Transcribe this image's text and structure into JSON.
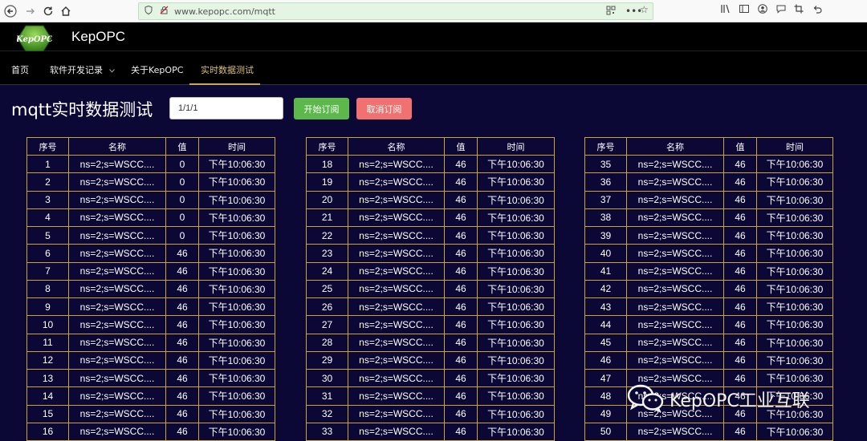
{
  "browser": {
    "url": "www.kepopc.com/mqtt"
  },
  "site": {
    "logo_text": "KepOPC",
    "title": "KepOPC"
  },
  "nav": {
    "items": [
      {
        "label": "首页"
      },
      {
        "label": "软件开发记录"
      },
      {
        "label": "关于KepOPC"
      },
      {
        "label": "实时数据测试"
      }
    ]
  },
  "page": {
    "title": "mqtt实时数据测试",
    "topic_value": "1/1/1",
    "subscribe_label": "开始订阅",
    "unsubscribe_label": "取消订阅"
  },
  "table": {
    "headers": [
      "序号",
      "名称",
      "值",
      "时间"
    ],
    "groups": [
      {
        "rows": [
          [
            "1",
            "ns=2;s=WSCC....",
            "0",
            "下午10:06:30"
          ],
          [
            "2",
            "ns=2;s=WSCC....",
            "0",
            "下午10:06:30"
          ],
          [
            "3",
            "ns=2;s=WSCC....",
            "0",
            "下午10:06:30"
          ],
          [
            "4",
            "ns=2;s=WSCC....",
            "0",
            "下午10:06:30"
          ],
          [
            "5",
            "ns=2;s=WSCC....",
            "0",
            "下午10:06:30"
          ],
          [
            "6",
            "ns=2;s=WSCC....",
            "46",
            "下午10:06:30"
          ],
          [
            "7",
            "ns=2;s=WSCC....",
            "46",
            "下午10:06:30"
          ],
          [
            "8",
            "ns=2;s=WSCC....",
            "46",
            "下午10:06:30"
          ],
          [
            "9",
            "ns=2;s=WSCC....",
            "46",
            "下午10:06:30"
          ],
          [
            "10",
            "ns=2;s=WSCC....",
            "46",
            "下午10:06:30"
          ],
          [
            "11",
            "ns=2;s=WSCC....",
            "46",
            "下午10:06:30"
          ],
          [
            "12",
            "ns=2;s=WSCC....",
            "46",
            "下午10:06:30"
          ],
          [
            "13",
            "ns=2;s=WSCC....",
            "46",
            "下午10:06:30"
          ],
          [
            "14",
            "ns=2;s=WSCC....",
            "46",
            "下午10:06:30"
          ],
          [
            "15",
            "ns=2;s=WSCC....",
            "46",
            "下午10:06:30"
          ],
          [
            "16",
            "ns=2;s=WSCC....",
            "46",
            "下午10:06:30"
          ]
        ]
      },
      {
        "rows": [
          [
            "18",
            "ns=2;s=WSCC....",
            "46",
            "下午10:06:30"
          ],
          [
            "19",
            "ns=2;s=WSCC....",
            "46",
            "下午10:06:30"
          ],
          [
            "20",
            "ns=2;s=WSCC....",
            "46",
            "下午10:06:30"
          ],
          [
            "21",
            "ns=2;s=WSCC....",
            "46",
            "下午10:06:30"
          ],
          [
            "22",
            "ns=2;s=WSCC....",
            "46",
            "下午10:06:30"
          ],
          [
            "23",
            "ns=2;s=WSCC....",
            "46",
            "下午10:06:30"
          ],
          [
            "24",
            "ns=2;s=WSCC....",
            "46",
            "下午10:06:30"
          ],
          [
            "25",
            "ns=2;s=WSCC....",
            "46",
            "下午10:06:30"
          ],
          [
            "26",
            "ns=2;s=WSCC....",
            "46",
            "下午10:06:30"
          ],
          [
            "27",
            "ns=2;s=WSCC....",
            "46",
            "下午10:06:30"
          ],
          [
            "28",
            "ns=2;s=WSCC....",
            "46",
            "下午10:06:30"
          ],
          [
            "29",
            "ns=2;s=WSCC....",
            "46",
            "下午10:06:30"
          ],
          [
            "30",
            "ns=2;s=WSCC....",
            "46",
            "下午10:06:30"
          ],
          [
            "31",
            "ns=2;s=WSCC....",
            "46",
            "下午10:06:30"
          ],
          [
            "32",
            "ns=2;s=WSCC....",
            "46",
            "下午10:06:30"
          ],
          [
            "33",
            "ns=2;s=WSCC....",
            "46",
            "下午10:06:30"
          ]
        ]
      },
      {
        "rows": [
          [
            "35",
            "ns=2;s=WSCC....",
            "46",
            "下午10:06:30"
          ],
          [
            "36",
            "ns=2;s=WSCC....",
            "46",
            "下午10:06:30"
          ],
          [
            "37",
            "ns=2;s=WSCC....",
            "46",
            "下午10:06:30"
          ],
          [
            "38",
            "ns=2;s=WSCC....",
            "46",
            "下午10:06:30"
          ],
          [
            "39",
            "ns=2;s=WSCC....",
            "46",
            "下午10:06:30"
          ],
          [
            "40",
            "ns=2;s=WSCC....",
            "46",
            "下午10:06:30"
          ],
          [
            "41",
            "ns=2;s=WSCC....",
            "46",
            "下午10:06:30"
          ],
          [
            "42",
            "ns=2;s=WSCC....",
            "46",
            "下午10:06:30"
          ],
          [
            "43",
            "ns=2;s=WSCC....",
            "46",
            "下午10:06:30"
          ],
          [
            "44",
            "ns=2;s=WSCC....",
            "46",
            "下午10:06:30"
          ],
          [
            "45",
            "ns=2;s=WSCC....",
            "46",
            "下午10:06:30"
          ],
          [
            "46",
            "ns=2;s=WSCC....",
            "46",
            "下午10:06:30"
          ],
          [
            "47",
            "ns=2;s=WSCC....",
            "46",
            "下午10:06:30"
          ],
          [
            "48",
            "ns=2;s=WSCC....",
            "46",
            "下午10:06:30"
          ],
          [
            "49",
            "ns=2;s=WSCC....",
            "46",
            "下午10:06:30"
          ],
          [
            "50",
            "ns=2;s=WSCC....",
            "46",
            "下午10:06:30"
          ]
        ]
      }
    ]
  },
  "watermark": {
    "text": "KepOPC工业互联"
  },
  "colors": {
    "page_bg": "#0c0836",
    "header_bg": "#000000",
    "table_border": "#c9a53a",
    "nav_active": "#d9c07c",
    "subscribe_bg": "#5cb84b",
    "unsubscribe_bg": "#f0716f",
    "url_bar_bg": "#e4f5e4"
  },
  "icons": {
    "back": "back-arrow-icon",
    "forward": "forward-arrow-icon",
    "reload": "reload-icon",
    "home": "home-icon",
    "shield": "shield-icon",
    "insecure": "insecure-lock-icon",
    "qr": "qr-code-icon",
    "more": "more-dots-icon",
    "bookmark": "bookmark-star-icon",
    "library": "library-icon",
    "sidebar": "sidebar-icon",
    "account": "account-icon",
    "chat": "chat-icon",
    "screenshot": "screenshot-icon",
    "undo": "undo-icon",
    "dropdown": "chevron-down-icon",
    "wechat": "wechat-icon"
  }
}
